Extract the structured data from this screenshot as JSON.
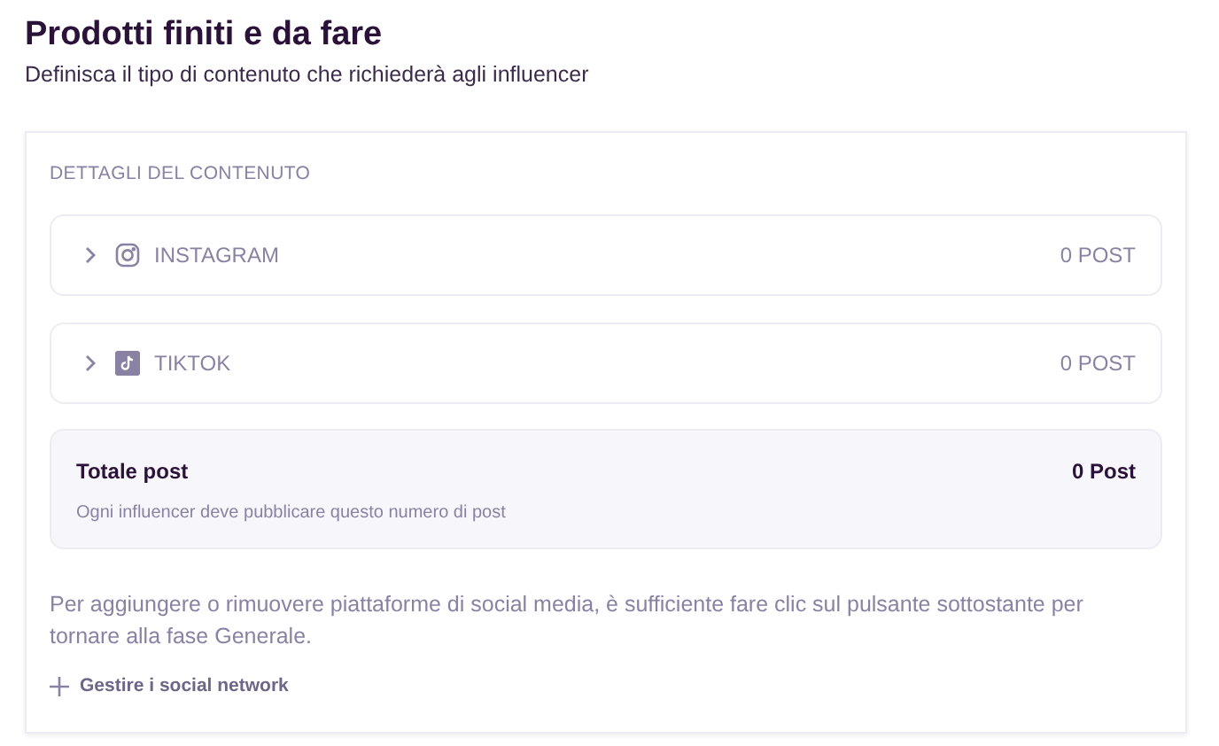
{
  "header": {
    "title": "Prodotti finiti e da fare",
    "subtitle": "Definisca il tipo di contenuto che richiederà agli influencer"
  },
  "card": {
    "section_label": "DETTAGLI DEL CONTENUTO",
    "platforms": [
      {
        "kind": "instagram",
        "name": "INSTAGRAM",
        "count": "0 POST",
        "expanded": false
      },
      {
        "kind": "tiktok",
        "name": "TIKTOK",
        "count": "0 POST",
        "expanded": false
      }
    ],
    "total": {
      "label": "Totale post",
      "value": "0 Post",
      "note": "Ogni influencer deve pubblicare questo numero di post"
    },
    "info": "Per aggiungere o rimuovere piattaforme di social media, è sufficiente fare clic sul pulsante sottostante per tornare alla fase Generale.",
    "action": "Gestire i social network"
  }
}
